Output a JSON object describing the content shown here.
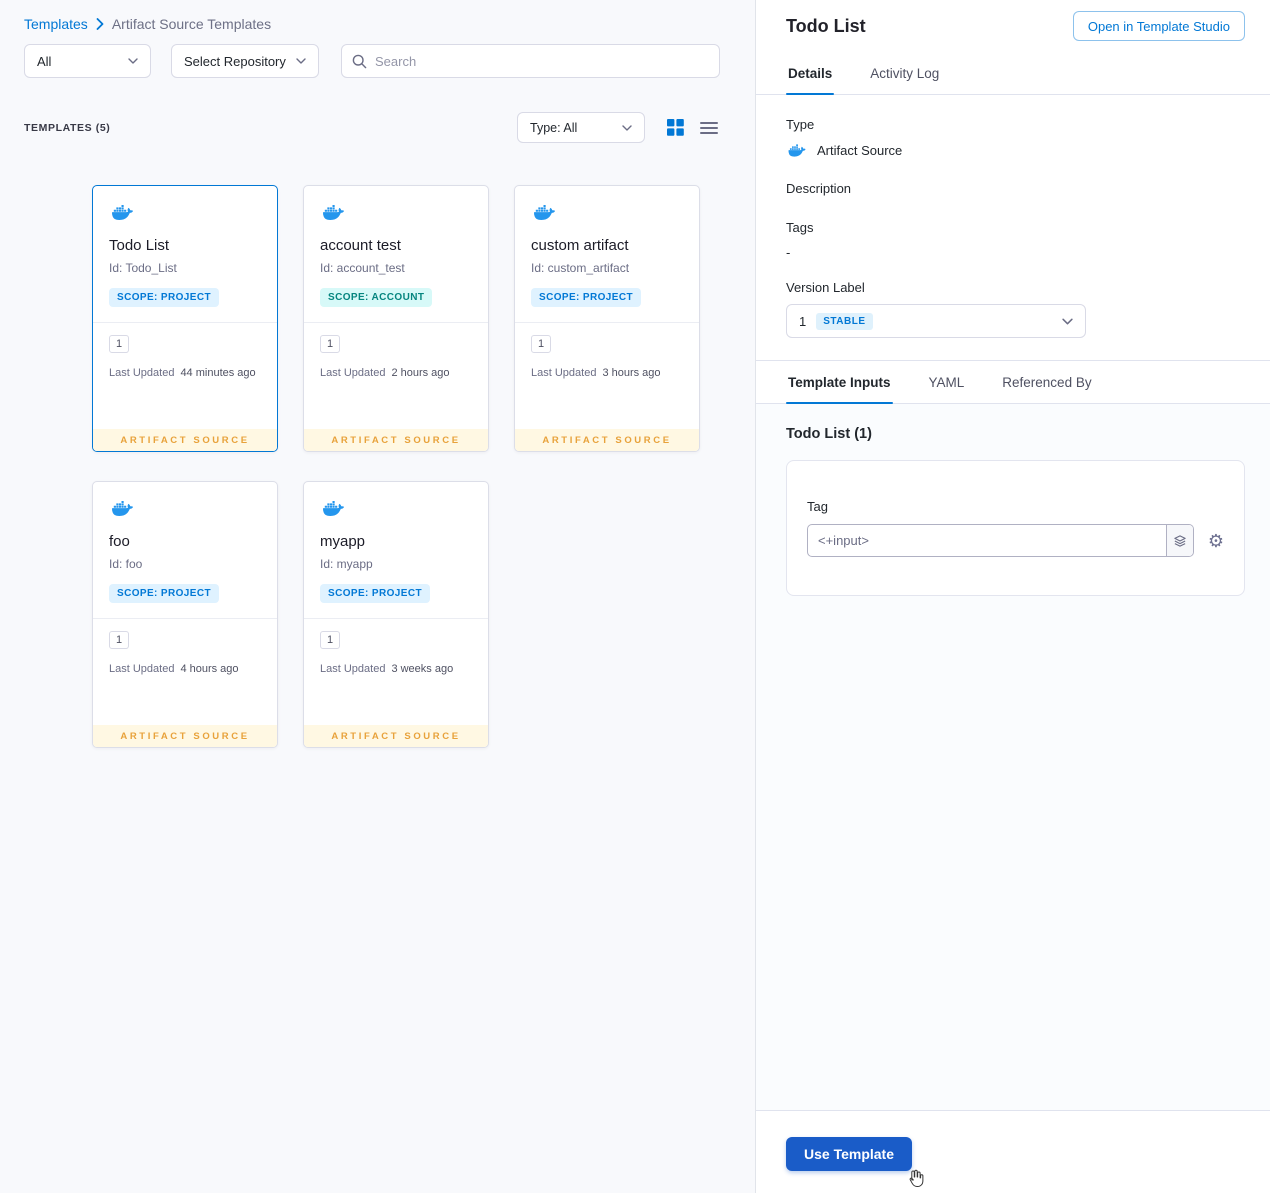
{
  "breadcrumb": {
    "root": "Templates",
    "current": "Artifact Source Templates"
  },
  "filters": {
    "scope": "All",
    "repository": "Select Repository",
    "search_placeholder": "Search"
  },
  "list_header": {
    "count": "TEMPLATES (5)",
    "type_filter": "Type: All"
  },
  "cards": [
    {
      "title": "Todo List",
      "id": "Id: Todo_List",
      "scope": "SCOPE: PROJECT",
      "version": "1",
      "updated_label": "Last Updated",
      "updated": "44 minutes ago",
      "footer": "ARTIFACT SOURCE",
      "selected": true
    },
    {
      "title": "account test",
      "id": "Id: account_test",
      "scope": "SCOPE: ACCOUNT",
      "version": "1",
      "updated_label": "Last Updated",
      "updated": "2 hours ago",
      "footer": "ARTIFACT SOURCE",
      "selected": false
    },
    {
      "title": "custom artifact",
      "id": "Id: custom_artifact",
      "scope": "SCOPE: PROJECT",
      "version": "1",
      "updated_label": "Last Updated",
      "updated": "3 hours ago",
      "footer": "ARTIFACT SOURCE",
      "selected": false
    },
    {
      "title": "foo",
      "id": "Id: foo",
      "scope": "SCOPE: PROJECT",
      "version": "1",
      "updated_label": "Last Updated",
      "updated": "4 hours ago",
      "footer": "ARTIFACT SOURCE",
      "selected": false
    },
    {
      "title": "myapp",
      "id": "Id: myapp",
      "scope": "SCOPE: PROJECT",
      "version": "1",
      "updated_label": "Last Updated",
      "updated": "3 weeks ago",
      "footer": "ARTIFACT SOURCE",
      "selected": false
    }
  ],
  "panel": {
    "title": "Todo List",
    "open_button": "Open in Template Studio",
    "tabs": {
      "details": "Details",
      "activity": "Activity Log"
    },
    "details": {
      "type_label": "Type",
      "type_value": "Artifact Source",
      "description_label": "Description",
      "tags_label": "Tags",
      "tags_value": "-",
      "version_label": "Version Label",
      "version_value": "1",
      "version_badge": "STABLE"
    },
    "input_tabs": {
      "inputs": "Template Inputs",
      "yaml": "YAML",
      "referenced": "Referenced By"
    },
    "inputs": {
      "title": "Todo List (1)",
      "tag_label": "Tag",
      "tag_value": "<+input>"
    },
    "use_template": "Use Template"
  },
  "colors": {
    "primary": "#0278d5",
    "docker_blue": "#2496ed",
    "scope_project_bg": "#dff2ff",
    "scope_project_text": "#0278d5",
    "scope_account_bg": "#d7f9f8",
    "scope_account_text": "#06857f",
    "artifact_source_bg": "#fff8e3",
    "artifact_source_text": "#e8a23b",
    "stable_badge_bg": "#dff1fc",
    "use_template_button_bg": "#1a5cc8"
  }
}
